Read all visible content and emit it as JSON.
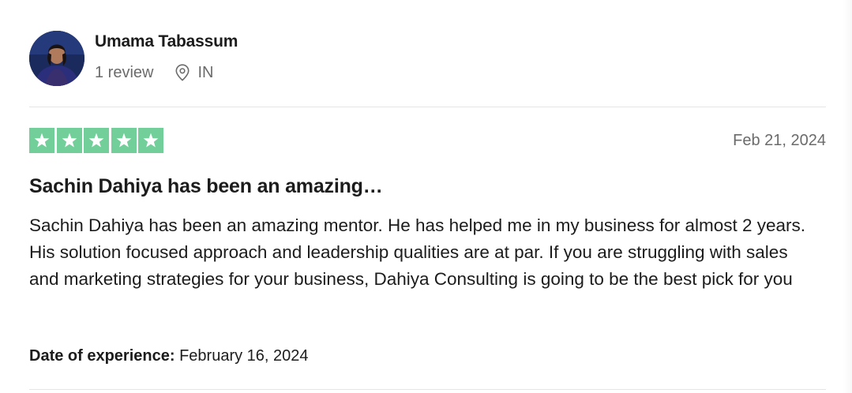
{
  "reviewer": {
    "name": "Umama Tabassum",
    "review_count": "1 review",
    "country": "IN"
  },
  "review": {
    "rating": 5,
    "rating_max": 5,
    "star_color": "#73cf9a",
    "date": "Feb 21, 2024",
    "title": "Sachin Dahiya has been an amazing…",
    "body": "Sachin Dahiya has been an amazing mentor. He has helped me in my business for almost 2 years. His solution focused approach and leadership qualities are at par. If you are struggling with sales and marketing strategies for your business, Dahiya Consulting is going to be the best pick for you",
    "experience_label": "Date of experience:",
    "experience_date": "February 16, 2024"
  },
  "icons": {
    "location": "map-pin-icon",
    "star": "star-icon"
  }
}
